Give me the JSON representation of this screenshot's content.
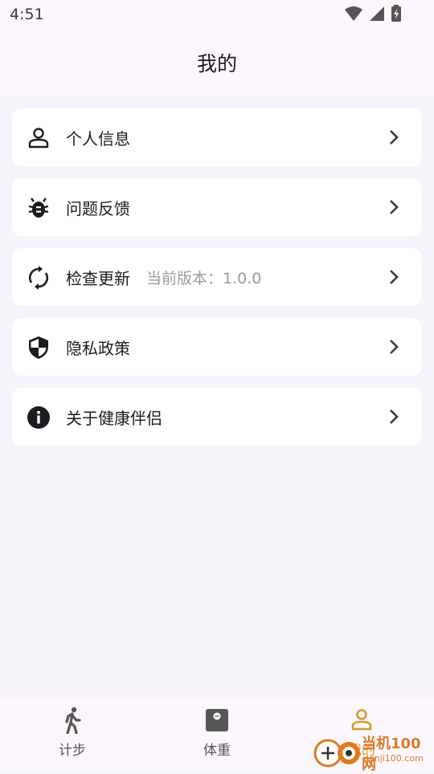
{
  "status_bar": {
    "time": "4:51"
  },
  "header": {
    "title": "我的"
  },
  "menu": [
    {
      "label": "个人信息",
      "icon": "person-icon"
    },
    {
      "label": "问题反馈",
      "icon": "bug-icon"
    },
    {
      "label": "检查更新",
      "sub": "当前版本：1.0.0",
      "icon": "refresh-icon"
    },
    {
      "label": "隐私政策",
      "icon": "shield-icon"
    },
    {
      "label": "关于健康伴侣",
      "icon": "info-icon"
    }
  ],
  "bottom_nav": [
    {
      "label": "计步",
      "icon": "walk-icon",
      "active": false
    },
    {
      "label": "体重",
      "icon": "scale-icon",
      "active": false
    },
    {
      "label": "我的",
      "icon": "person-icon",
      "active": true
    }
  ],
  "watermark": {
    "brand": "当机100网",
    "url": "danji100.com"
  },
  "colors": {
    "accent": "#d79a2a",
    "background": "#f6f3fb",
    "card": "#ffffff"
  }
}
